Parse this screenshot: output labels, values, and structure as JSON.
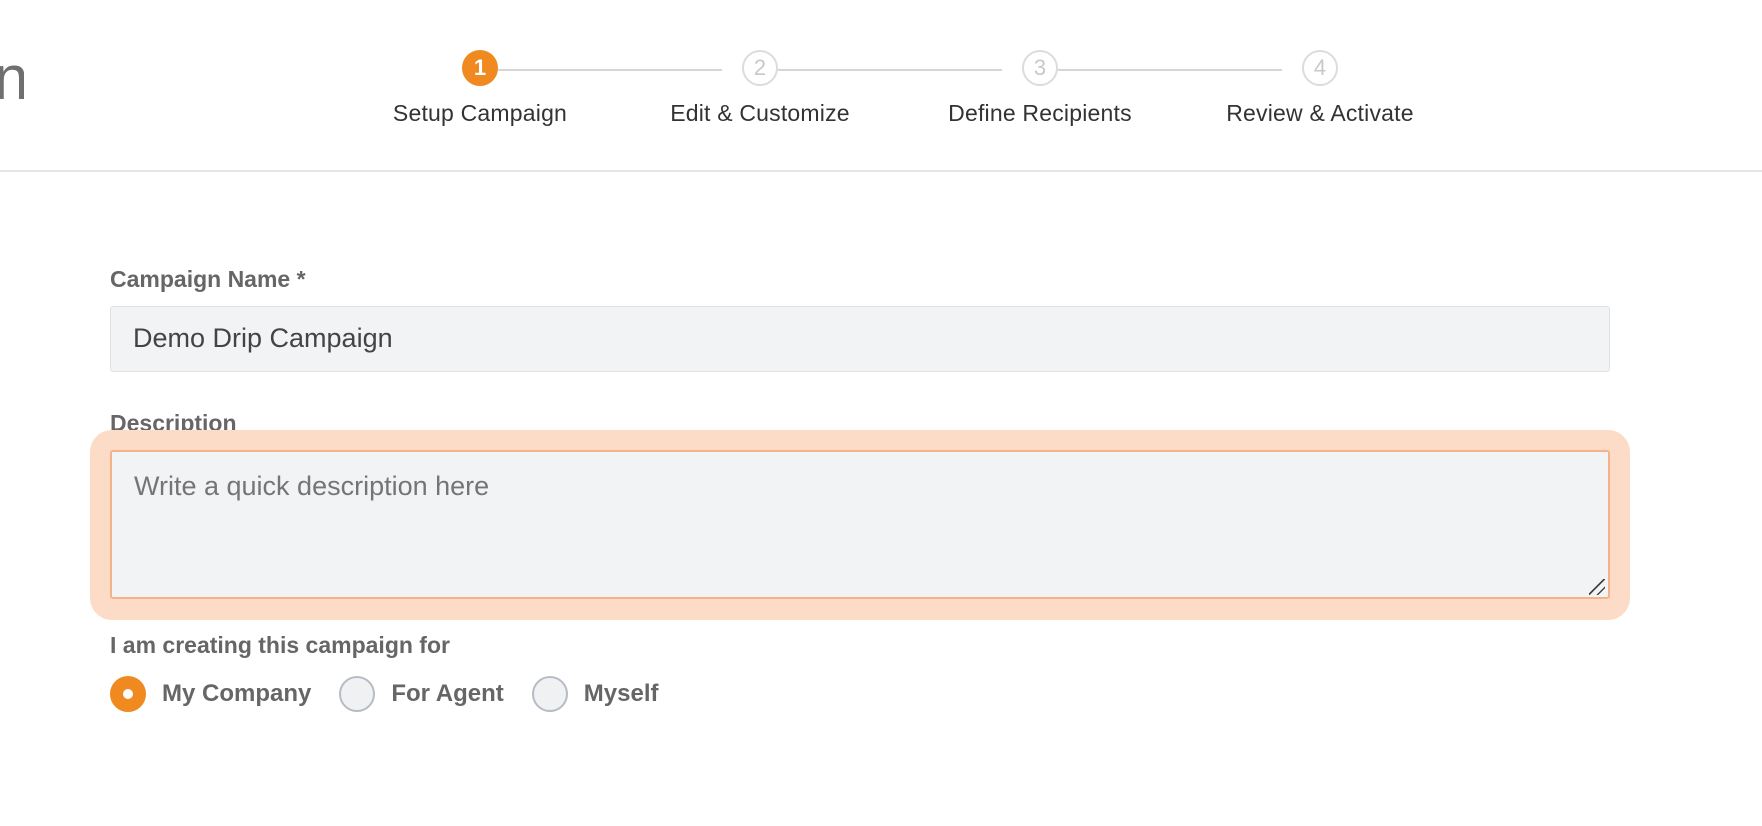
{
  "header": {
    "title_fragment": "n"
  },
  "stepper": {
    "steps": [
      {
        "number": "1",
        "label": "Setup Campaign",
        "state": "active"
      },
      {
        "number": "2",
        "label": "Edit & Customize",
        "state": "pending"
      },
      {
        "number": "3",
        "label": "Define Recipients",
        "state": "pending"
      },
      {
        "number": "4",
        "label": "Review & Activate",
        "state": "pending"
      }
    ]
  },
  "form": {
    "campaign_name": {
      "label": "Campaign Name *",
      "value": "Demo Drip Campaign"
    },
    "description": {
      "label": "Description",
      "placeholder": "Write a quick description here",
      "value": ""
    },
    "creating_for": {
      "label": "I am creating this campaign for",
      "options": [
        {
          "label": "My Company",
          "checked": true
        },
        {
          "label": "For Agent",
          "checked": false
        },
        {
          "label": "Myself",
          "checked": false
        }
      ]
    }
  },
  "colors": {
    "accent": "#f08a20",
    "focus_halo": "#fcdcc6",
    "input_bg": "#f2f3f5"
  }
}
